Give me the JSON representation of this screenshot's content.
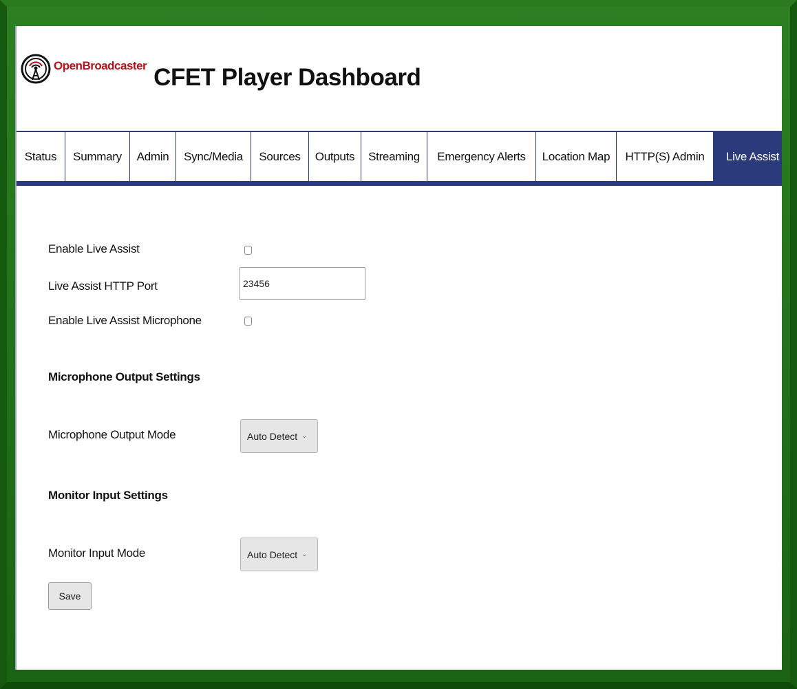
{
  "header": {
    "logo_text": "OpenBroadcaster",
    "title": "CFET Player Dashboard"
  },
  "tabs": [
    {
      "label": "Status"
    },
    {
      "label": "Summary"
    },
    {
      "label": "Admin"
    },
    {
      "label": "Sync/Media"
    },
    {
      "label": "Sources"
    },
    {
      "label": "Outputs"
    },
    {
      "label": "Streaming"
    },
    {
      "label": "Emergency Alerts"
    },
    {
      "label": "Location Map"
    },
    {
      "label": "HTTP(S) Admin"
    },
    {
      "label": "Live Assist",
      "active": true
    }
  ],
  "form": {
    "enable_live_assist_label": "Enable Live Assist",
    "enable_live_assist_checked": false,
    "http_port_label": "Live Assist HTTP Port",
    "http_port_value": "23456",
    "enable_microphone_label": "Enable Live Assist Microphone",
    "enable_microphone_checked": false,
    "mic_output_heading": "Microphone Output Settings",
    "mic_output_mode_label": "Microphone Output Mode",
    "mic_output_mode_value": "Auto Detect",
    "monitor_input_heading": "Monitor Input Settings",
    "monitor_input_mode_label": "Monitor Input Mode",
    "monitor_input_mode_value": "Auto Detect",
    "save_label": "Save"
  },
  "colors": {
    "frame_green": "#1e6b17",
    "tab_navy": "#2b3a7a",
    "logo_red": "#b5121b"
  },
  "icons": {
    "logo": "broadcast-tower-icon",
    "select_arrow": "chevron-down-icon"
  }
}
